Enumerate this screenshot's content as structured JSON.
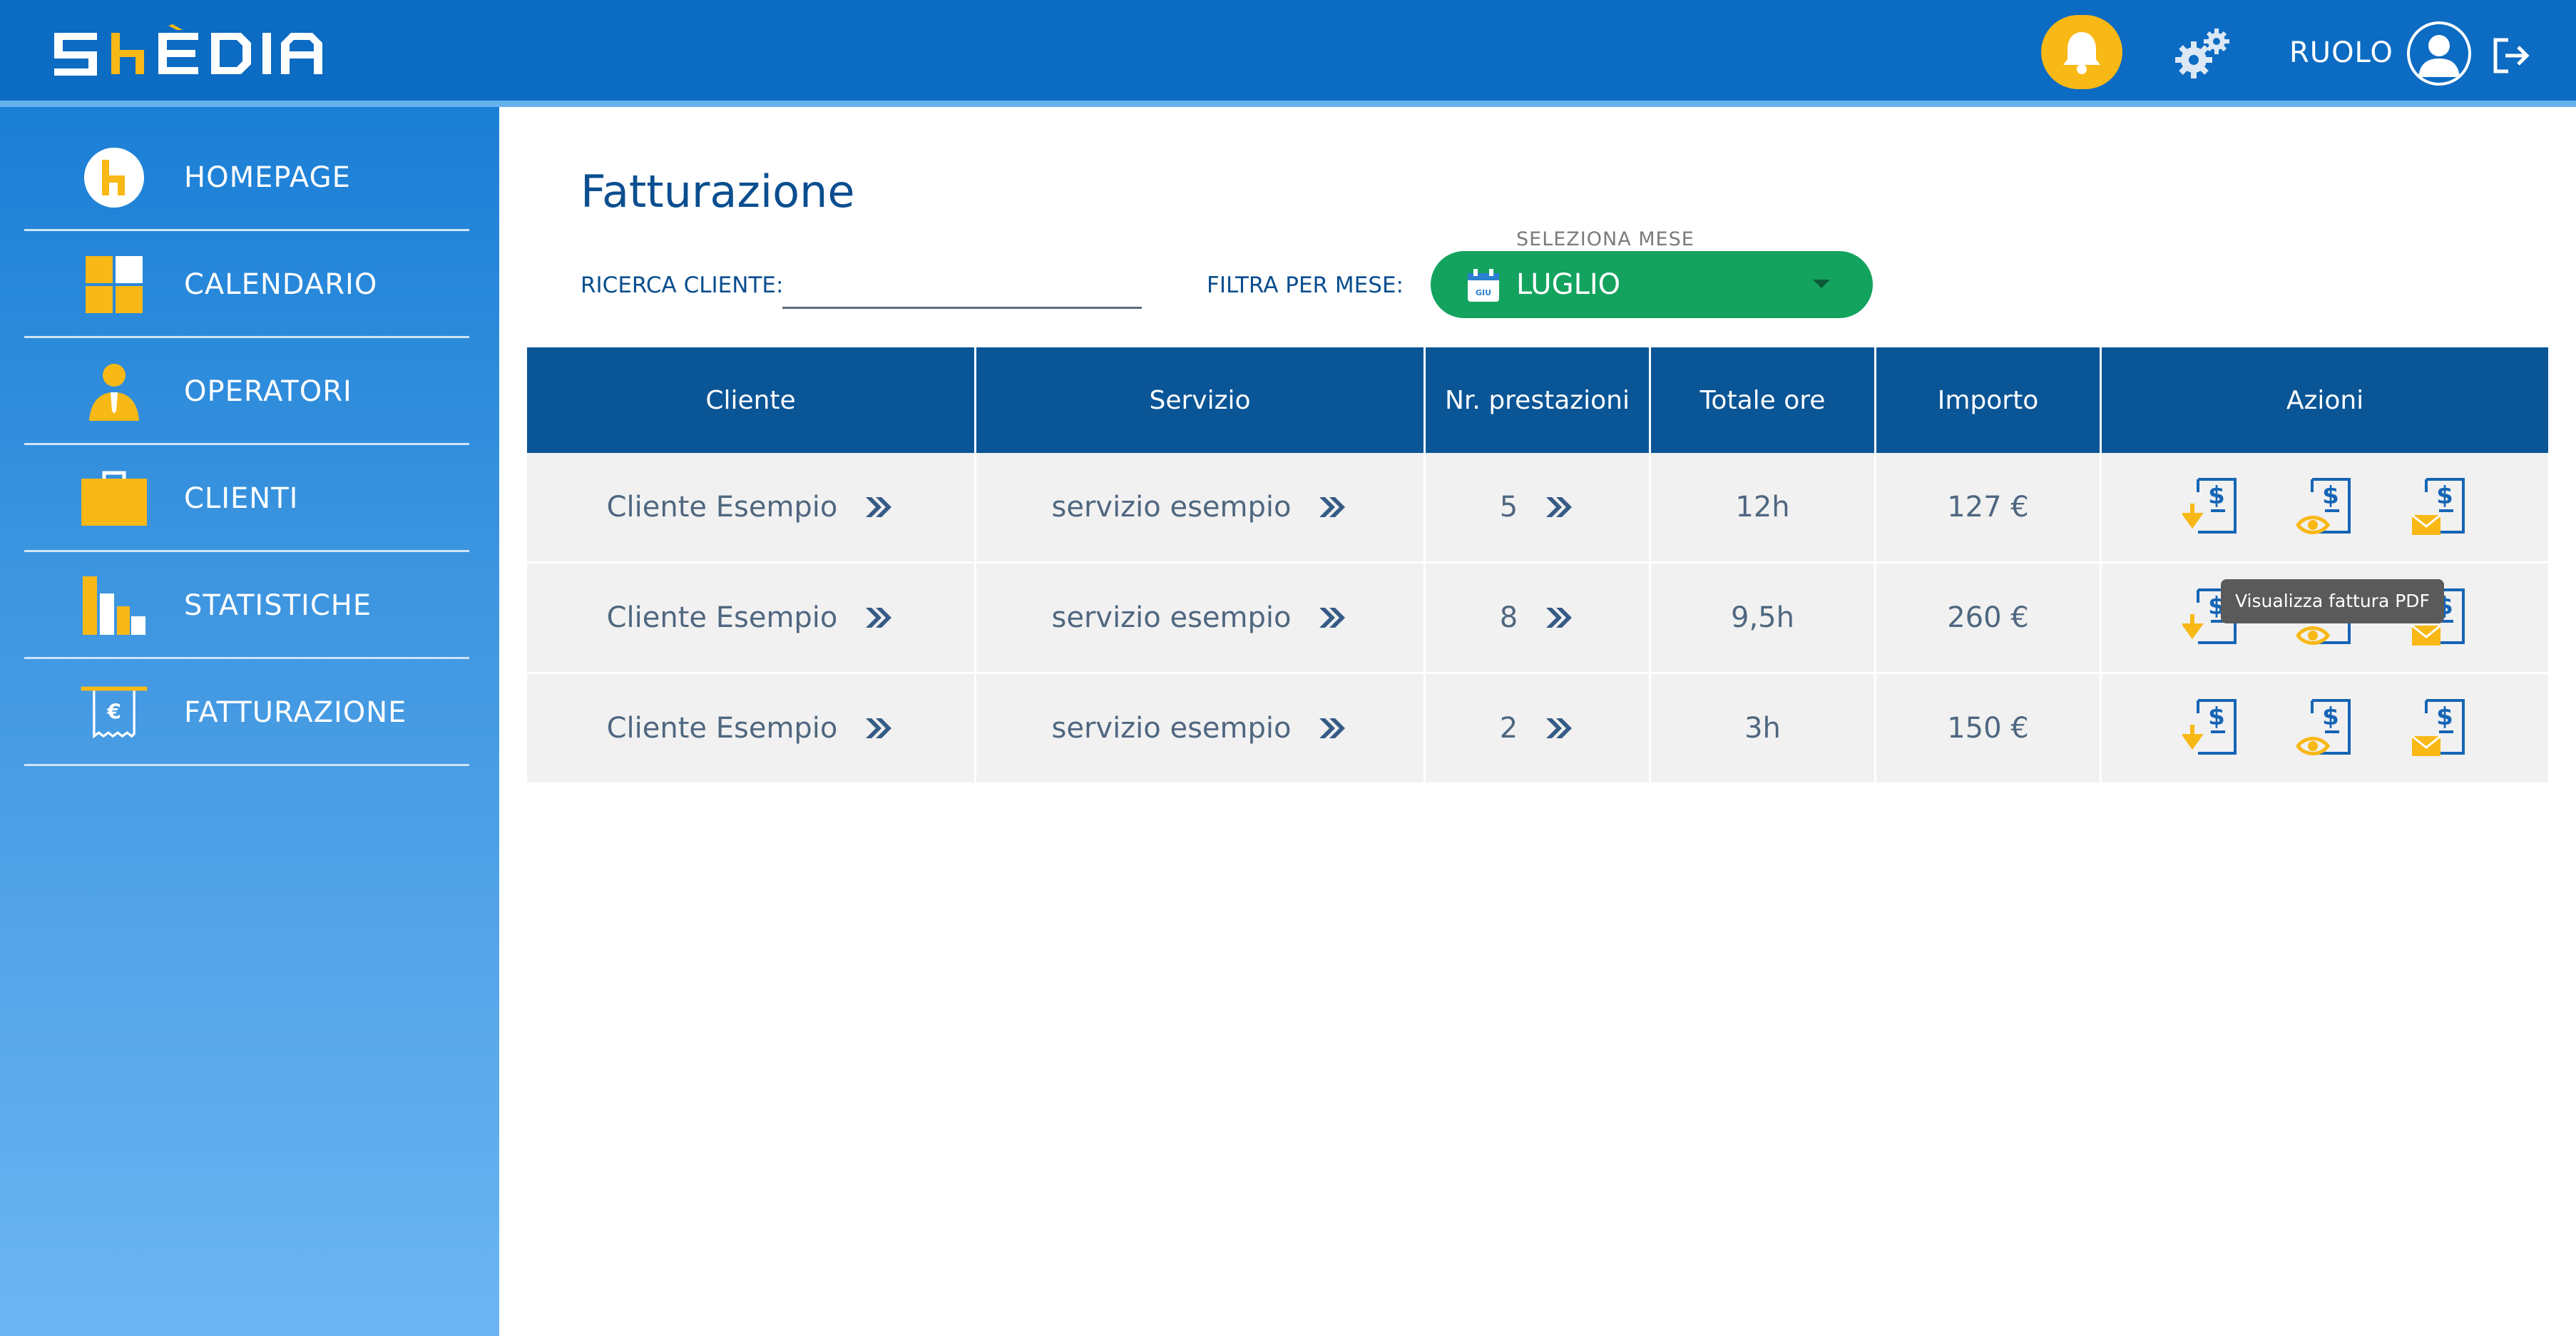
{
  "app": {
    "logo_text": "SKEDIA",
    "role_label": "RUOLO",
    "colors": {
      "primary": "#0c6bc2",
      "accent": "#f8b816",
      "green": "#13a35e",
      "header_dark": "#0a5596"
    }
  },
  "sidebar": {
    "items": [
      {
        "label": "HOMEPAGE",
        "icon": "home-logo-icon"
      },
      {
        "label": "CALENDARIO",
        "icon": "calendar-grid-icon"
      },
      {
        "label": "OPERATORI",
        "icon": "operator-icon"
      },
      {
        "label": "CLIENTI",
        "icon": "briefcase-icon"
      },
      {
        "label": "STATISTICHE",
        "icon": "bar-chart-icon"
      },
      {
        "label": "FATTURAZIONE",
        "icon": "invoice-euro-icon"
      }
    ]
  },
  "main": {
    "title": "Fatturazione",
    "search_label": "RICERCA CLIENTE:",
    "search_value": "",
    "month_filter_label": "FILTRA PER MESE:",
    "month_hint": "SELEZIONA MESE",
    "month_icon_text": "GIU",
    "month_value": "LUGLIO"
  },
  "table": {
    "headers": [
      "Cliente",
      "Servizio",
      "Nr. prestazioni",
      "Totale ore",
      "Importo",
      "Azioni"
    ],
    "rows": [
      {
        "cliente": "Cliente Esempio",
        "servizio": "servizio esempio",
        "prestazioni": "5",
        "ore": "12h",
        "importo": "127 €"
      },
      {
        "cliente": "Cliente Esempio",
        "servizio": "servizio esempio",
        "prestazioni": "8",
        "ore": "9,5h",
        "importo": "260 €"
      },
      {
        "cliente": "Cliente Esempio",
        "servizio": "servizio esempio",
        "prestazioni": "2",
        "ore": "3h",
        "importo": "150 €"
      }
    ],
    "action_icons": [
      "download-invoice-icon",
      "view-invoice-icon",
      "email-invoice-icon"
    ]
  },
  "tooltip": {
    "text": "Visualizza fattura PDF"
  }
}
